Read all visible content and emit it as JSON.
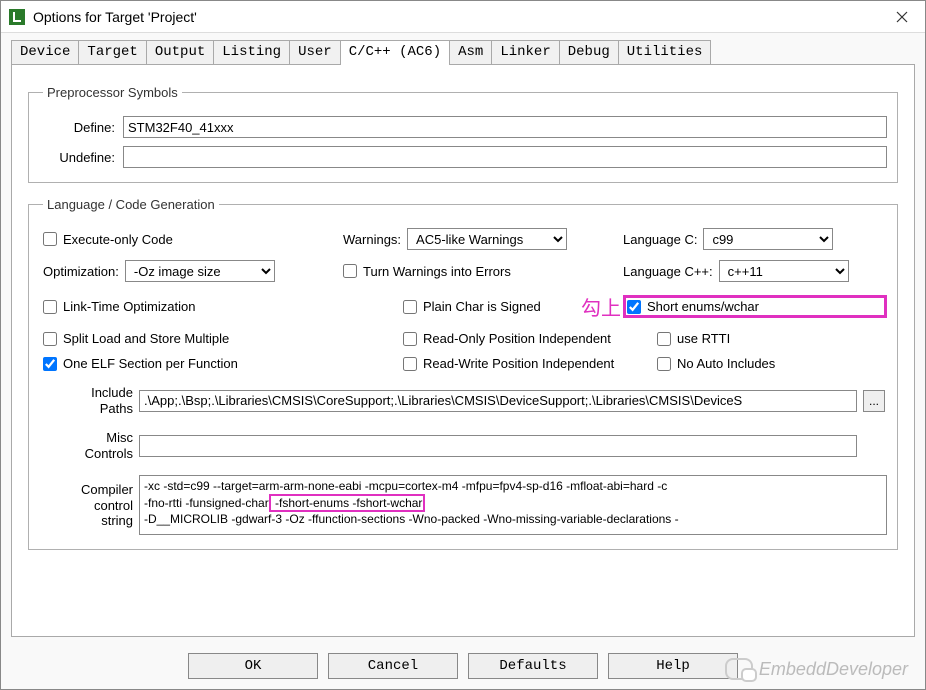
{
  "title": "Options for Target 'Project'",
  "tabs": [
    "Device",
    "Target",
    "Output",
    "Listing",
    "User",
    "C/C++ (AC6)",
    "Asm",
    "Linker",
    "Debug",
    "Utilities"
  ],
  "active_tab_index": 5,
  "preprocessor": {
    "legend": "Preprocessor Symbols",
    "define_label": "Define:",
    "define_value": "STM32F40_41xxx",
    "undefine_label": "Undefine:",
    "undefine_value": ""
  },
  "lang": {
    "legend": "Language / Code Generation",
    "execute_only": "Execute-only Code",
    "warnings_label": "Warnings:",
    "warnings_value": "AC5-like Warnings",
    "language_c_label": "Language C:",
    "language_c_value": "c99",
    "optimization_label": "Optimization:",
    "optimization_value": "-Oz image size",
    "turn_warnings_errors": "Turn Warnings into Errors",
    "language_cpp_label": "Language C++:",
    "language_cpp_value": "c++11",
    "link_time_opt": "Link-Time Optimization",
    "plain_char_signed": "Plain Char is Signed",
    "annotation": "勾上",
    "short_enums": "Short enums/wchar",
    "split_load_store": "Split Load and Store Multiple",
    "readonly_pos_ind": "Read-Only Position Independent",
    "use_rtti": "use RTTI",
    "one_elf": "One ELF Section per Function",
    "readwrite_pos_ind": "Read-Write Position Independent",
    "no_auto_includes": "No Auto Includes"
  },
  "paths": {
    "include_label": "Include\nPaths",
    "include_value": ".\\App;.\\Bsp;.\\Libraries\\CMSIS\\CoreSupport;.\\Libraries\\CMSIS\\DeviceSupport;.\\Libraries\\CMSIS\\DeviceS",
    "misc_label": "Misc\nControls",
    "misc_value": "",
    "compiler_label": "Compiler\ncontrol\nstring",
    "compiler_line1": "-xc -std=c99 --target=arm-arm-none-eabi -mcpu=cortex-m4 -mfpu=fpv4-sp-d16 -mfloat-abi=hard -c",
    "compiler_line2a": "-fno-rtti -funsigned-char",
    "compiler_line2_hl": " -fshort-enums -fshort-wchar ",
    "compiler_line3": "-D__MICROLIB -gdwarf-3 -Oz -ffunction-sections -Wno-packed -Wno-missing-variable-declarations -"
  },
  "buttons": {
    "ok": "OK",
    "cancel": "Cancel",
    "defaults": "Defaults",
    "help": "Help"
  },
  "watermark": "EmbeddDeveloper"
}
